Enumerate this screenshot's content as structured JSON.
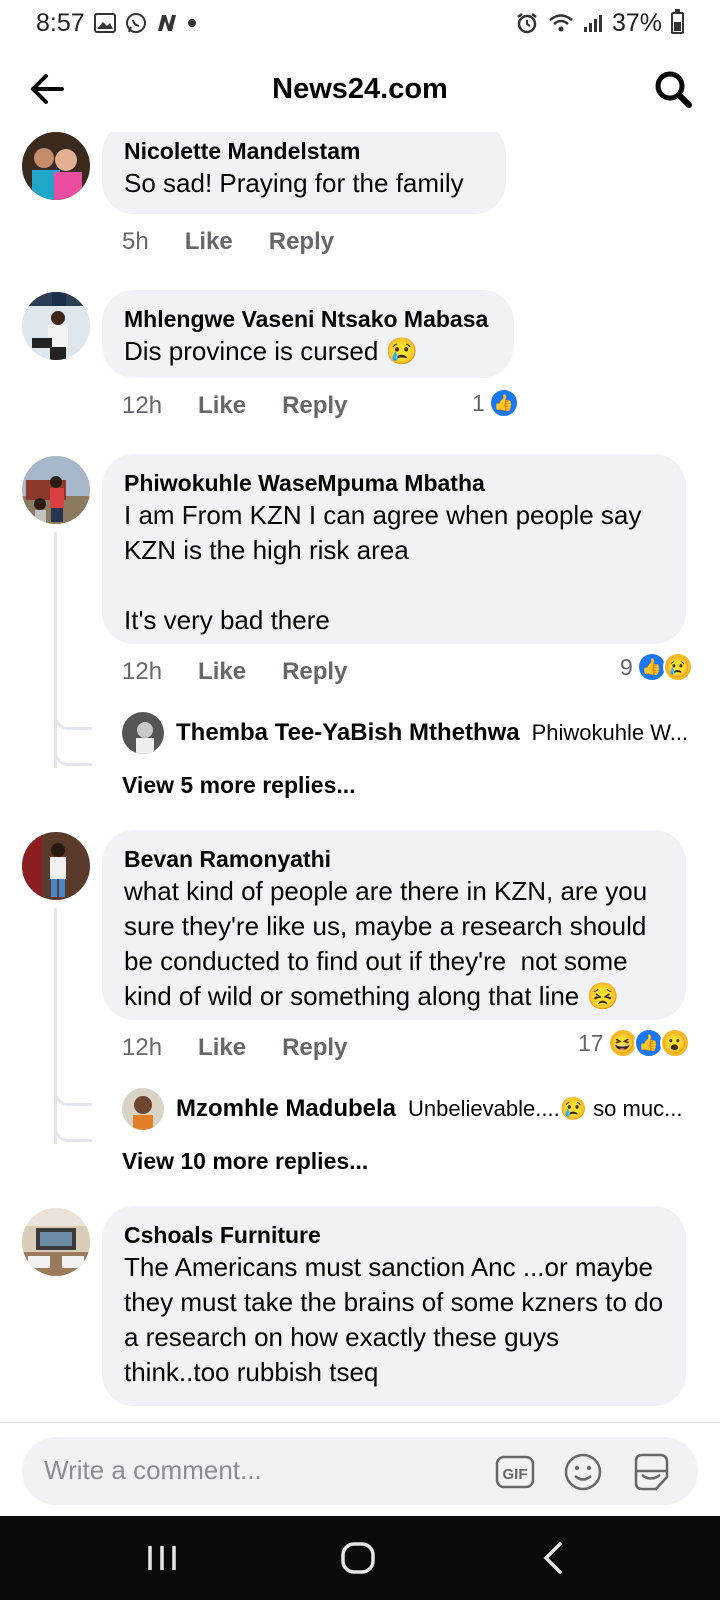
{
  "status_bar": {
    "time": "8:57",
    "battery": "37%",
    "left_icons": [
      "gallery-icon",
      "whatsapp-icon",
      "n-app-icon",
      "dot-icon"
    ],
    "right_icons": [
      "alarm-icon",
      "wifi-icon",
      "signal-icon",
      "battery-icon"
    ]
  },
  "header": {
    "title": "News24.com"
  },
  "comments": [
    {
      "name": "Nicolette Mandelstam",
      "text": "So sad! Praying for the family",
      "time": "5h",
      "like": "Like",
      "reply": "Reply"
    },
    {
      "name": "Mhlengwe Vaseni Ntsako Mabasa",
      "text": "Dis province is cursed 😢",
      "time": "12h",
      "like": "Like",
      "reply": "Reply",
      "reaction_count": "1",
      "reactions": [
        "like"
      ]
    },
    {
      "name": "Phiwokuhle WaseMpuma Mbatha",
      "text": "I am From KZN I can agree when people say KZN is the high risk area\n\nIt's very bad there",
      "time": "12h",
      "like": "Like",
      "reply": "Reply",
      "reaction_count": "9",
      "reactions": [
        "like",
        "sad"
      ],
      "reply_preview": {
        "name": "Themba Tee-YaBish Mthethwa",
        "text": "Phiwokuhle W..."
      },
      "view_more": "View 5 more replies..."
    },
    {
      "name": "Bevan Ramonyathi",
      "text": "what kind of people are there in KZN, are you sure they're like us, maybe a research should be conducted to find out if they're  not some kind of wild or something along that line 😣",
      "time": "12h",
      "like": "Like",
      "reply": "Reply",
      "reaction_count": "17",
      "reactions": [
        "haha",
        "like",
        "wow"
      ],
      "reply_preview": {
        "name": "Mzomhle Madubela",
        "text": "Unbelievable....😢 so muc..."
      },
      "view_more": "View 10 more replies..."
    },
    {
      "name": "Cshoals Furniture",
      "text": "The Americans must sanction Anc ...or maybe they must take the brains of some kzners to do a research on how exactly these guys think..too rubbish tseq"
    }
  ],
  "composer": {
    "placeholder": "Write a comment...",
    "icons": [
      "gif-icon",
      "emoji-icon",
      "sticker-icon"
    ]
  },
  "nav_bar": {
    "icons": [
      "recent-apps-icon",
      "home-icon",
      "back-icon"
    ]
  },
  "colors": {
    "bubble": "#f0f2f5",
    "secondary_text": "#65676b",
    "like_blue": "#1877f2",
    "emoji_yellow": "#f7b928"
  }
}
